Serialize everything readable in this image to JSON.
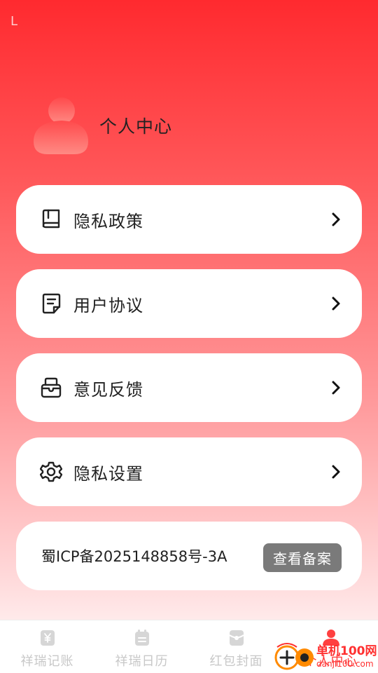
{
  "status": {
    "indicator": "L"
  },
  "profile": {
    "title": "个人中心",
    "avatar_icon": "user-avatar-icon"
  },
  "menu": [
    {
      "label": "隐私政策",
      "icon": "book-icon"
    },
    {
      "label": "用户协议",
      "icon": "document-icon"
    },
    {
      "label": "意见反馈",
      "icon": "feedback-box-icon"
    },
    {
      "label": "隐私设置",
      "icon": "gear-icon"
    }
  ],
  "icp": {
    "text": "蜀ICP备2025148858号-3A",
    "button": "查看备案"
  },
  "tabbar": {
    "tabs": [
      {
        "label": "祥瑞记账",
        "icon": "yen-note-icon",
        "active": false
      },
      {
        "label": "祥瑞日历",
        "icon": "calendar-icon",
        "active": false
      },
      {
        "label": "红包封面",
        "icon": "red-envelope-icon",
        "active": false
      },
      {
        "label": "个人中心",
        "icon": "person-icon",
        "active": true
      }
    ]
  },
  "watermark": {
    "top": "单机100网",
    "bottom": "danji100.com"
  },
  "colors": {
    "accent": "#ff3b3b",
    "header_top": "#ff2a2f",
    "inactive": "#c8c8c8"
  }
}
